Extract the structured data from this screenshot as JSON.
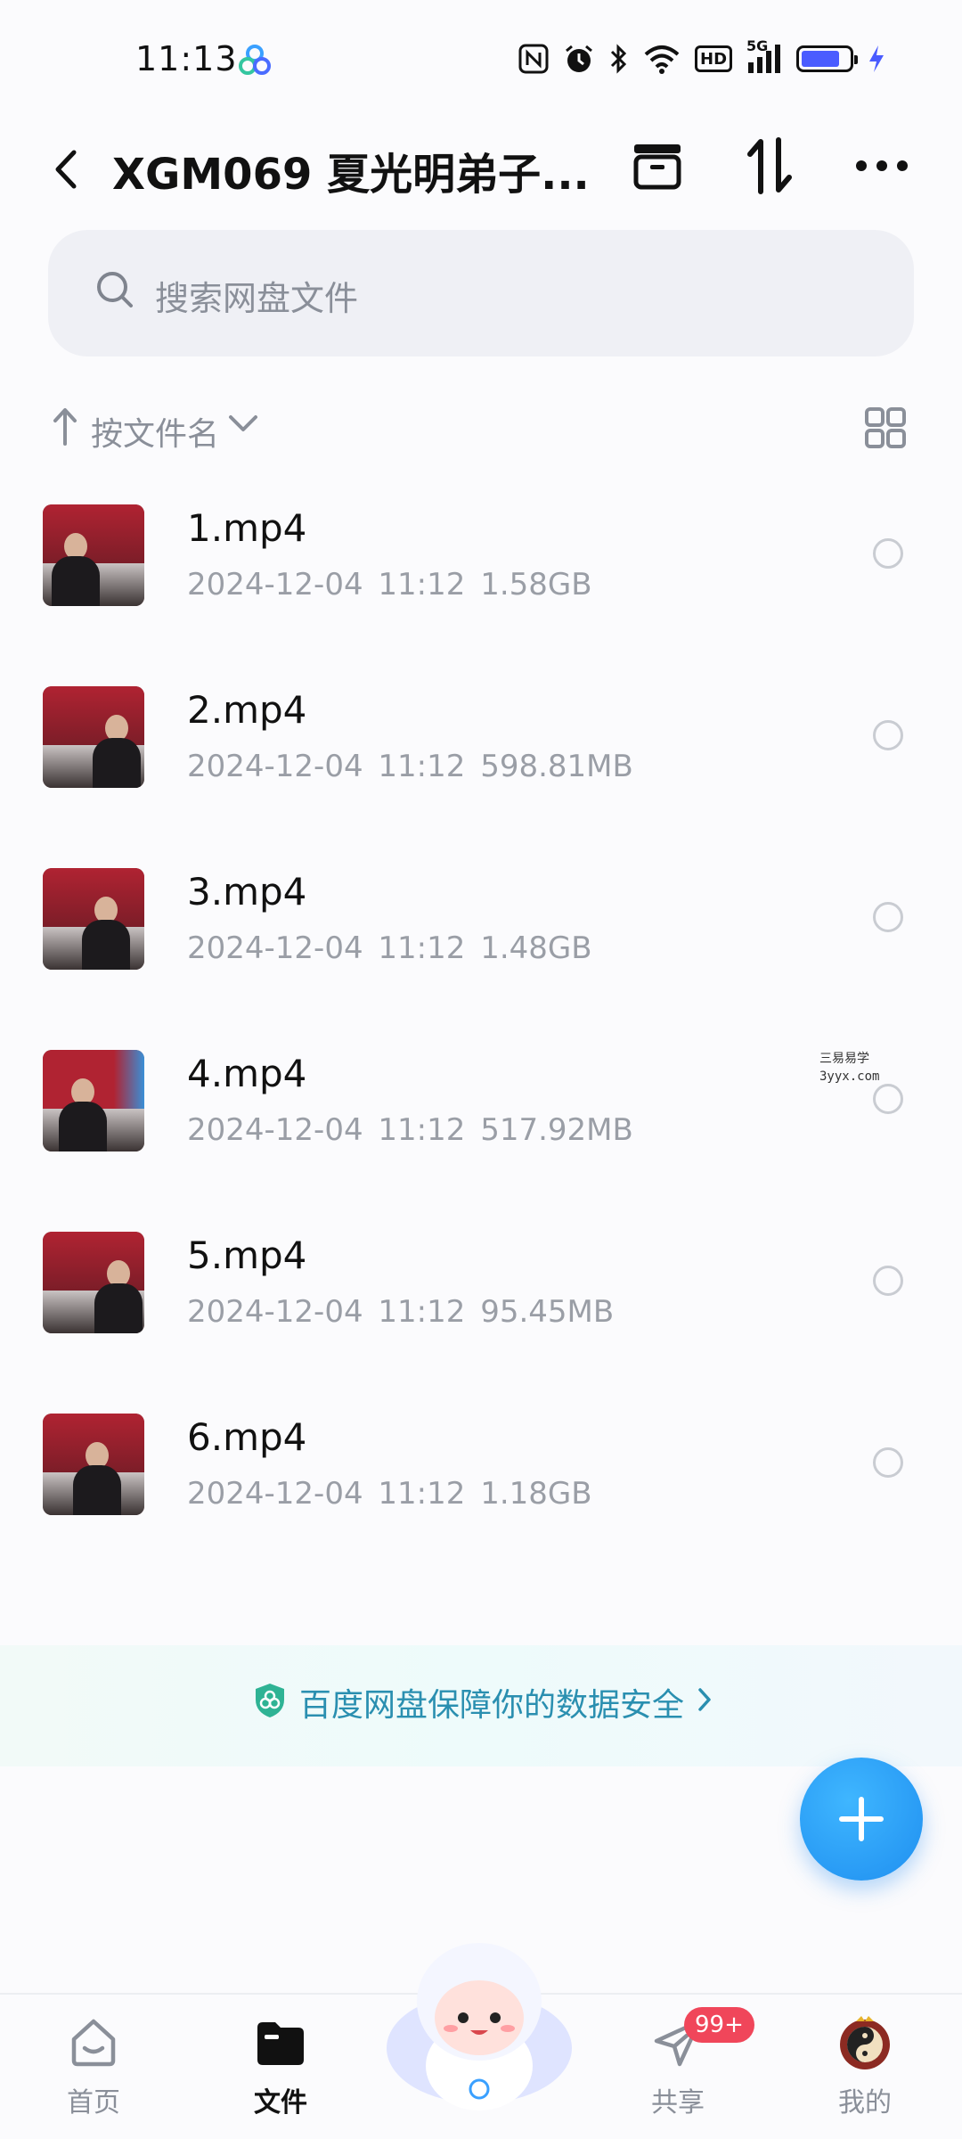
{
  "status_bar": {
    "time": "11:13",
    "network": "5G",
    "hd_label": "HD"
  },
  "header": {
    "title": "XGM069 夏光明弟子..."
  },
  "search": {
    "placeholder": "搜索网盘文件"
  },
  "sort": {
    "label": "按文件名"
  },
  "files": [
    {
      "name": "1.mp4",
      "date": "2024-12-04",
      "time": "11:12",
      "size": "1.58GB"
    },
    {
      "name": "2.mp4",
      "date": "2024-12-04",
      "time": "11:12",
      "size": "598.81MB"
    },
    {
      "name": "3.mp4",
      "date": "2024-12-04",
      "time": "11:12",
      "size": "1.48GB"
    },
    {
      "name": "4.mp4",
      "date": "2024-12-04",
      "time": "11:12",
      "size": "517.92MB"
    },
    {
      "name": "5.mp4",
      "date": "2024-12-04",
      "time": "11:12",
      "size": "95.45MB"
    },
    {
      "name": "6.mp4",
      "date": "2024-12-04",
      "time": "11:12",
      "size": "1.18GB"
    }
  ],
  "watermark": {
    "line1": "三易易学",
    "line2": "3yyx.com"
  },
  "security_banner": {
    "text": "百度网盘保障你的数据安全"
  },
  "bottom_nav": {
    "home": "首页",
    "files": "文件",
    "share": "共享",
    "share_badge": "99+",
    "mine": "我的"
  },
  "colors": {
    "accent": "#1f8ff0",
    "badge": "#f0465a",
    "security_text": "#2a8fb0",
    "battery": "#4a5cff"
  }
}
